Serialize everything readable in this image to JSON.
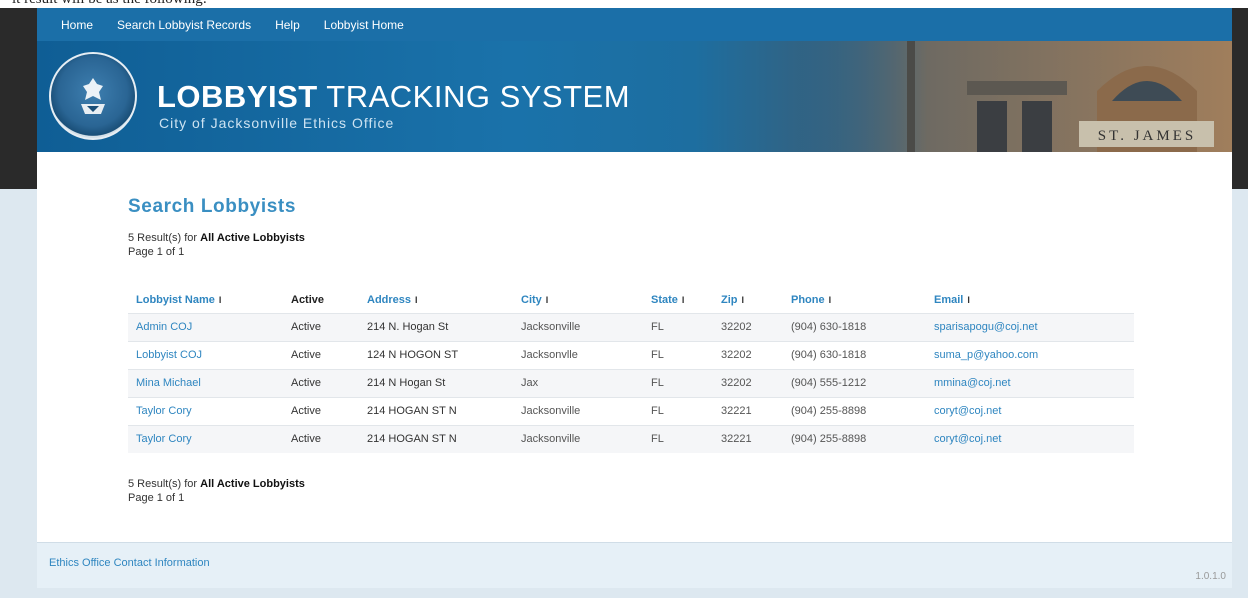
{
  "window": {
    "caption_fragment": "lt result will be as the following:"
  },
  "nav": {
    "items": [
      "Home",
      "Search Lobbyist Records",
      "Help",
      "Lobbyist Home"
    ]
  },
  "banner": {
    "title_bold": "LOBBYIST",
    "title_rest": " TRACKING SYSTEM",
    "subtitle": "City of Jacksonville Ethics Office",
    "building_sign": "ST. JAMES"
  },
  "search": {
    "title": "Search Lobbyists",
    "result_prefix": "5 Result(s) for ",
    "result_query": "All Active Lobbyists",
    "page_info": "Page 1 of 1"
  },
  "table": {
    "headers": [
      "Lobbyist Name",
      "Active",
      "Address",
      "City",
      "State",
      "Zip",
      "Phone",
      "Email"
    ],
    "sortable": [
      true,
      false,
      true,
      true,
      true,
      true,
      true,
      true
    ],
    "sort_glyph": "I",
    "rows": [
      [
        "Admin COJ",
        "Active",
        "214 N. Hogan St",
        "Jacksonville",
        "FL",
        "32202",
        "(904) 630-1818",
        "sparisapogu@coj.net"
      ],
      [
        "Lobbyist COJ",
        "Active",
        "124 N HOGON ST",
        "Jacksonvlle",
        "FL",
        "32202",
        "(904) 630-1818",
        "suma_p@yahoo.com"
      ],
      [
        "Mina Michael",
        "Active",
        "214 N Hogan St",
        "Jax",
        "FL",
        "32202",
        "(904) 555-1212",
        "mmina@coj.net"
      ],
      [
        "Taylor Cory",
        "Active",
        "214 HOGAN ST N",
        "Jacksonville",
        "FL",
        "32221",
        "(904) 255-8898",
        "coryt@coj.net"
      ],
      [
        "Taylor Cory",
        "Active",
        "214 HOGAN ST N",
        "Jacksonville",
        "FL",
        "32221",
        "(904) 255-8898",
        "coryt@coj.net"
      ]
    ]
  },
  "footer": {
    "contact_link": "Ethics Office Contact Information",
    "version": "1.0.1.0"
  },
  "colors": {
    "nav_bg": "#1b6fa8",
    "link": "#2f86c0",
    "page_bg": "#dde8f0"
  }
}
